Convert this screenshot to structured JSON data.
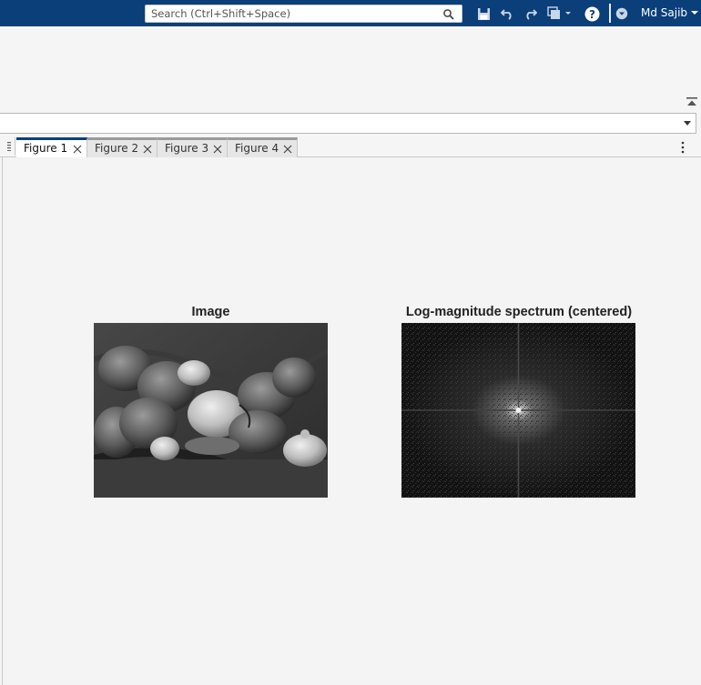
{
  "toolbar": {
    "search_placeholder": "Search (Ctrl+Shift+Space)",
    "user_name": "Md Sajib",
    "icons": [
      "save-icon",
      "undo-icon",
      "redo-icon",
      "switch-windows-icon",
      "help-icon",
      "community-icon"
    ]
  },
  "tabs": [
    {
      "label": "Figure 1",
      "active": true
    },
    {
      "label": "Figure 2",
      "active": false
    },
    {
      "label": "Figure 3",
      "active": false
    },
    {
      "label": "Figure 4",
      "active": false
    }
  ],
  "figure": {
    "left_title": "Image",
    "right_title": "Log-magnitude spectrum (centered)"
  },
  "colors": {
    "topbar": "#0b3f7a",
    "active_tab_accent": "#0b3f7a"
  }
}
